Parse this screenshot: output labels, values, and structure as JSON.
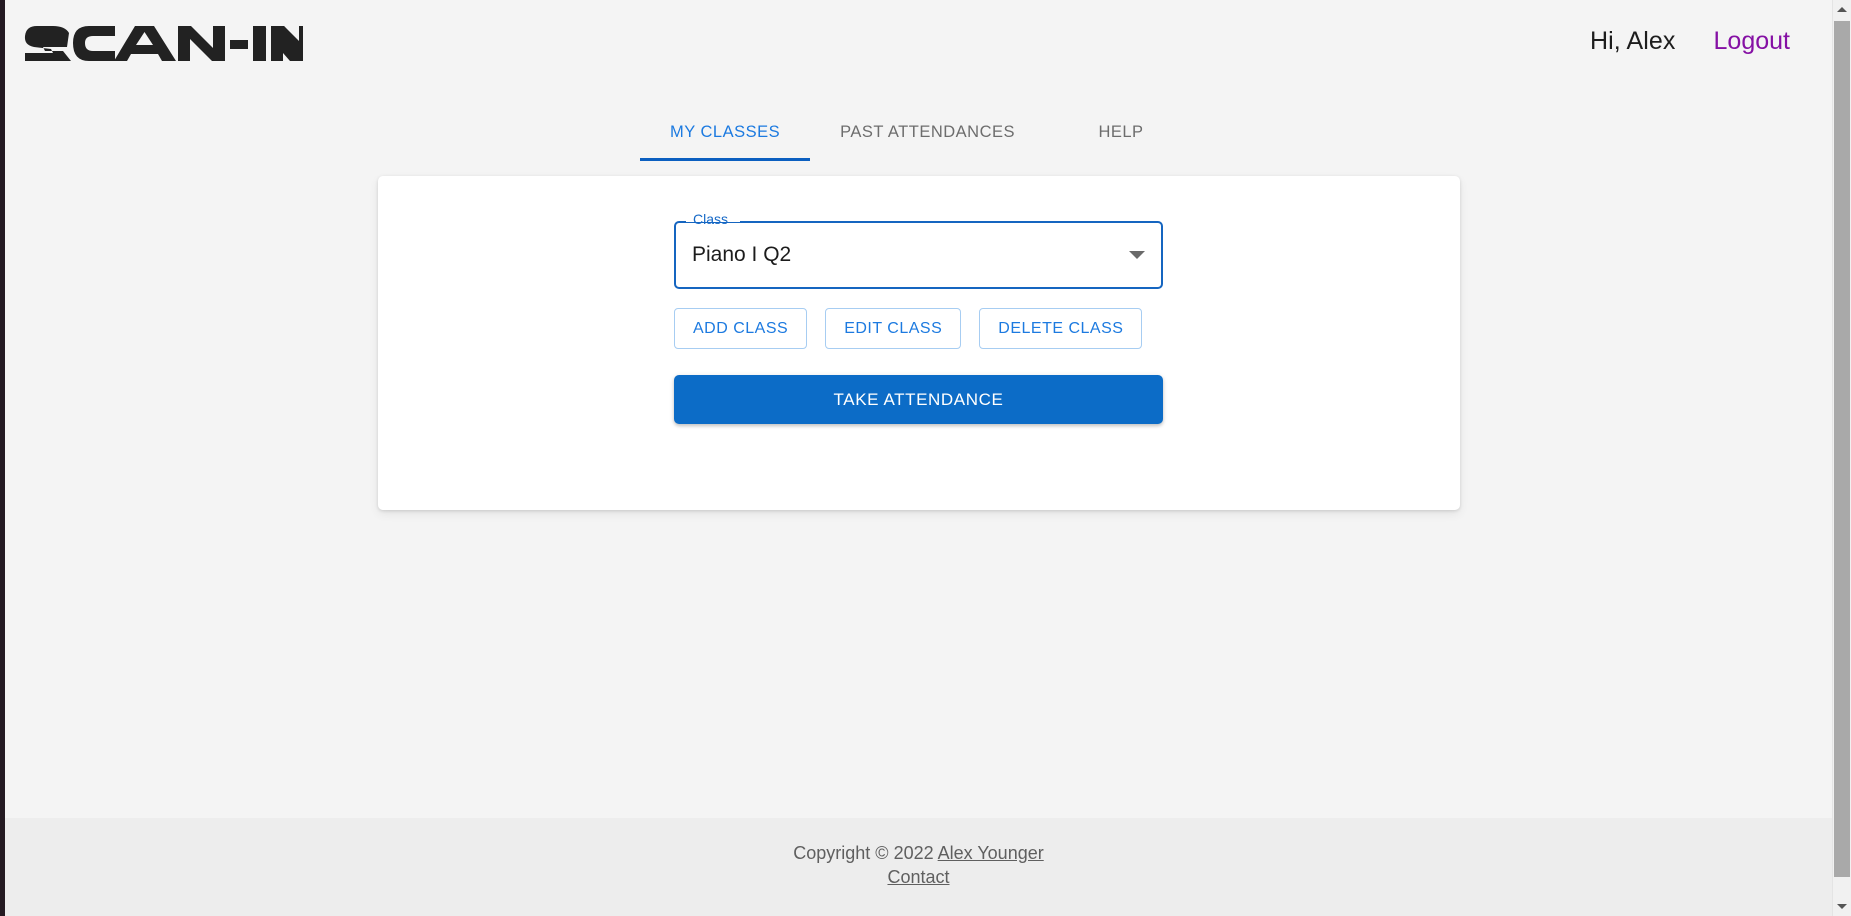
{
  "brand": {
    "name": "SCAN-IN",
    "logo_color": "#222222"
  },
  "header": {
    "greeting": "Hi, Alex",
    "logout_label": "Logout",
    "logout_color": "#8510a4"
  },
  "tabs": {
    "active_index": 0,
    "items": [
      {
        "label": "MY CLASSES"
      },
      {
        "label": "PAST ATTENDANCES"
      },
      {
        "label": "HELP"
      }
    ],
    "active_color": "#1c7ae0",
    "inactive_color": "#6d6d6d",
    "indicator_color": "#0b5fc0"
  },
  "card": {
    "class_field": {
      "label": "Class",
      "value": "Piano I Q2",
      "caret_icon": "chevron-down-icon",
      "border_color": "#1565c0",
      "label_color": "#1669c7"
    },
    "actions": [
      {
        "label": "Add Class",
        "display": "ADD CLASS",
        "name": "add-class-button"
      },
      {
        "label": "Edit Class",
        "display": "EDIT CLASS",
        "name": "edit-class-button"
      },
      {
        "label": "Delete Class",
        "display": "DELETE CLASS",
        "name": "delete-class-button"
      }
    ],
    "primary_action": {
      "display": "TAKE ATTENDANCE",
      "color": "#0c6cc7",
      "text_color": "#ffffff"
    }
  },
  "footer": {
    "copyright_prefix": "Copyright © 2022 ",
    "author_link": "Alex Younger",
    "contact_link": "Contact",
    "background": "#ededed",
    "text_color": "#5f5f5f"
  },
  "scrollbar": {
    "up_icon": "scroll-up-arrow-icon",
    "down_icon": "scroll-down-arrow-icon",
    "thumb_color": "#a9a9a9",
    "track_color": "#f1f1f1"
  },
  "page": {
    "background": "#f4f4f4",
    "card_background": "#ffffff"
  }
}
